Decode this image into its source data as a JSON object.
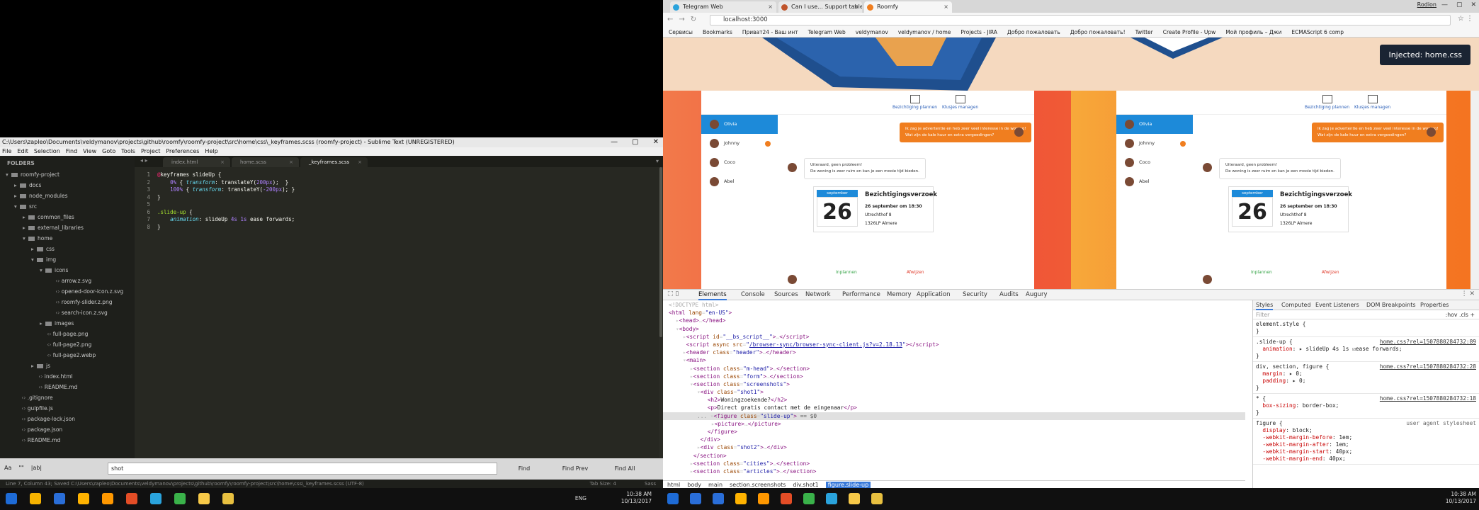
{
  "sublime": {
    "title": "C:\\Users\\zapleo\\Documents\\veldymanov\\projects\\github\\roomfy\\roomfy-project\\src\\home\\css\\_keyframes.scss (roomfy-project) - Sublime Text (UNREGISTERED)",
    "menu": [
      "File",
      "Edit",
      "Selection",
      "Find",
      "View",
      "Goto",
      "Tools",
      "Project",
      "Preferences",
      "Help"
    ],
    "sidebar_heading": "FOLDERS",
    "tree": [
      {
        "label": "roomfy-project",
        "depth": 0,
        "arrow": "▾",
        "folder": true
      },
      {
        "label": "docs",
        "depth": 1,
        "arrow": "▸",
        "folder": true
      },
      {
        "label": "node_modules",
        "depth": 1,
        "arrow": "▸",
        "folder": true
      },
      {
        "label": "src",
        "depth": 1,
        "arrow": "▾",
        "folder": true
      },
      {
        "label": "common_files",
        "depth": 2,
        "arrow": "▸",
        "folder": true
      },
      {
        "label": "external_libraries",
        "depth": 2,
        "arrow": "▸",
        "folder": true
      },
      {
        "label": "home",
        "depth": 2,
        "arrow": "▾",
        "folder": true
      },
      {
        "label": "css",
        "depth": 3,
        "arrow": "▸",
        "folder": true
      },
      {
        "label": "img",
        "depth": 3,
        "arrow": "▾",
        "folder": true
      },
      {
        "label": "icons",
        "depth": 4,
        "arrow": "▾",
        "folder": true
      },
      {
        "label": "arrow.z.svg",
        "depth": 5,
        "arrow": "",
        "folder": false
      },
      {
        "label": "opened-door-icon.z.svg",
        "depth": 5,
        "arrow": "",
        "folder": false
      },
      {
        "label": "roomfy-slider.z.png",
        "depth": 5,
        "arrow": "",
        "folder": false
      },
      {
        "label": "search-icon.z.svg",
        "depth": 5,
        "arrow": "",
        "folder": false
      },
      {
        "label": "images",
        "depth": 4,
        "arrow": "▸",
        "folder": true
      },
      {
        "label": "full-page.png",
        "depth": 4,
        "arrow": "",
        "folder": false
      },
      {
        "label": "full-page2.png",
        "depth": 4,
        "arrow": "",
        "folder": false
      },
      {
        "label": "full-page2.webp",
        "depth": 4,
        "arrow": "",
        "folder": false
      },
      {
        "label": "js",
        "depth": 3,
        "arrow": "▸",
        "folder": true
      },
      {
        "label": "index.html",
        "depth": 3,
        "arrow": "",
        "folder": false
      },
      {
        "label": "README.md",
        "depth": 3,
        "arrow": "",
        "folder": false
      },
      {
        "label": ".gitignore",
        "depth": 1,
        "arrow": "",
        "folder": false
      },
      {
        "label": "gulpfile.js",
        "depth": 1,
        "arrow": "",
        "folder": false
      },
      {
        "label": "package-lock.json",
        "depth": 1,
        "arrow": "",
        "folder": false
      },
      {
        "label": "package.json",
        "depth": 1,
        "arrow": "",
        "folder": false
      },
      {
        "label": "README.md",
        "depth": 1,
        "arrow": "",
        "folder": false
      }
    ],
    "tabs": [
      {
        "label": "index.html",
        "active": false
      },
      {
        "label": "home.scss",
        "active": false
      },
      {
        "label": "_keyframes.scss",
        "active": true
      }
    ],
    "code": [
      {
        "n": "1",
        "html": "<span style='color:#f92672'>@</span><span style='color:#f8f8f2'>keyframes slideUp {</span>"
      },
      {
        "n": "2",
        "html": "    <span style='color:#ae81ff'>0%</span> <span style='color:#f8f8f2'>{</span> <span style='color:#66d9ef;font-style:italic'>transform</span><span style='color:#f8f8f2'>: translateY(</span><span style='color:#ae81ff'>200px</span><span style='color:#f8f8f2'>);  }</span>"
      },
      {
        "n": "3",
        "html": "    <span style='color:#ae81ff'>100%</span> <span style='color:#f8f8f2'>{</span> <span style='color:#66d9ef;font-style:italic'>transform</span><span style='color:#f8f8f2'>: translateY(</span><span style='color:#ae81ff'>-200px</span><span style='color:#f8f8f2'>); }</span>"
      },
      {
        "n": "4",
        "html": "<span style='color:#f8f8f2'>}</span>"
      },
      {
        "n": "5",
        "html": ""
      },
      {
        "n": "6",
        "html": "<span style='color:#a6e22e'>.slide-up</span> <span style='color:#f8f8f2'>{</span>"
      },
      {
        "n": "7",
        "html": "    <span style='color:#66d9ef;font-style:italic'>animation</span><span style='color:#f8f8f2'>: slideUp </span><span style='color:#ae81ff'>4s</span> <span style='color:#ae81ff'>1s</span><span style='color:#f8f8f2'> ease forwards;</span>"
      },
      {
        "n": "8",
        "html": "<span style='color:#f8f8f2'>}</span>"
      }
    ],
    "find": {
      "opts": [
        "Aa",
        "\"\"",
        "|ab|"
      ],
      "value": "shot",
      "find": "Find",
      "find_prev": "Find Prev",
      "find_all": "Find All"
    },
    "status_left": "Line 7, Column 43; Saved C:\\Users\\zapleo\\Documents\\veldymanov\\projects\\github\\roomfy\\roomfy-project\\src\\home\\css\\_keyframes.scss (UTF-8)",
    "tab_size": "Tab Size: 4",
    "syntax": "Sass"
  },
  "chrome": {
    "tabs": [
      {
        "label": "Telegram Web",
        "active": false,
        "color": "#2aa3dc"
      },
      {
        "label": "Can I use... Support table",
        "active": false,
        "color": "#c0542b"
      },
      {
        "label": "Roomfy",
        "active": true,
        "color": "#f07e1f"
      }
    ],
    "user": "Rodion",
    "url": "localhost:3000",
    "bookmarks": [
      "Сервисы",
      "Bookmarks",
      "Приват24 - Ваш инт",
      "Telegram Web",
      "veldymanov",
      "veldymanov / home",
      "Projects - JIRA",
      "Добро пожаловать",
      "Добро пожаловать!",
      "Twitter",
      "Create Profile - Upw",
      "Мой профиль – Джи",
      "ECMAScript 6 comp"
    ],
    "injected": "Injected: home.css"
  },
  "mock": {
    "topbar": [
      "Bezichtiging plannen",
      "Klusjes managen"
    ],
    "contacts": [
      {
        "name": "Olivia",
        "active": true,
        "badge": false
      },
      {
        "name": "Johnny",
        "active": false,
        "badge": true
      },
      {
        "name": "Coco",
        "active": false,
        "badge": false
      },
      {
        "name": "Abel",
        "active": false,
        "badge": false
      }
    ],
    "msg1a": "Ik zag je advertentie en heb zeer veel interesse in de woning!",
    "msg1b": "Wat zijn de kale huur en extra vergoedingen?",
    "msg2a": "Uiteraard, geen probleem!",
    "msg2b": "De woning is zeer ruim en kan je een mooie tijd bieden.",
    "month": "september",
    "day": "26",
    "card_title": "Bezichtigingsverzoek",
    "card_when": "26 september om 18:30",
    "card_addr1": "Utrechthof 8",
    "card_addr2": "1326LP Almere",
    "accept": "Inplannen",
    "decline": "Afwijzen"
  },
  "devtools": {
    "tabs": [
      "Elements",
      "Console",
      "Sources",
      "Network",
      "Performance",
      "Memory",
      "Application",
      "Security",
      "Audits",
      "Augury"
    ],
    "dom": [
      {
        "i": 0,
        "h": "<span class='cm'>&lt;!DOCTYPE html&gt;</span>"
      },
      {
        "i": 0,
        "h": "<span class='tg'>&lt;html</span> <span class='at'>lang</span>=<span class='av2'>\"en-US\"</span><span class='tg'>&gt;</span>"
      },
      {
        "i": 1,
        "h": "▸<span class='tg'>&lt;head&gt;</span>…<span class='tg'>&lt;/head&gt;</span>"
      },
      {
        "i": 1,
        "h": "▾<span class='tg'>&lt;body&gt;</span>"
      },
      {
        "i": 2,
        "h": "▸<span class='tg'>&lt;script</span> <span class='at'>id</span>=<span class='av2'>\"__bs_script__\"</span><span class='tg'>&gt;</span>…<span class='tg'>&lt;/script&gt;</span>"
      },
      {
        "i": 2,
        "h": " <span class='tg'>&lt;script</span> <span class='at'>async src</span>=<span class='av2'>\"<span class='ln2'>/browser-sync/browser-sync-client.js?v=2.18.13</span>\"</span><span class='tg'>&gt;&lt;/script&gt;</span>"
      },
      {
        "i": 2,
        "h": "▸<span class='tg'>&lt;header</span> <span class='at'>class</span>=<span class='av2'>\"header\"</span><span class='tg'>&gt;</span>…<span class='tg'>&lt;/header&gt;</span>"
      },
      {
        "i": 2,
        "h": "▾<span class='tg'>&lt;main&gt;</span>"
      },
      {
        "i": 3,
        "h": "▸<span class='tg'>&lt;section</span> <span class='at'>class</span>=<span class='av2'>\"m-head\"</span><span class='tg'>&gt;</span>…<span class='tg'>&lt;/section&gt;</span>"
      },
      {
        "i": 3,
        "h": "▸<span class='tg'>&lt;section</span> <span class='at'>class</span>=<span class='av2'>\"form\"</span><span class='tg'>&gt;</span>…<span class='tg'>&lt;/section&gt;</span>"
      },
      {
        "i": 3,
        "h": "▾<span class='tg'>&lt;section</span> <span class='at'>class</span>=<span class='av2'>\"screenshots\"</span><span class='tg'>&gt;</span>"
      },
      {
        "i": 4,
        "h": "▾<span class='tg'>&lt;div</span> <span class='at'>class</span>=<span class='av2'>\"shot1\"</span><span class='tg'>&gt;</span>"
      },
      {
        "i": 5,
        "h": " <span class='tg'>&lt;h2&gt;</span><span class='tx'>Woningzoekende?</span><span class='tg'>&lt;/h2&gt;</span>"
      },
      {
        "i": 5,
        "h": " <span class='tg'>&lt;p&gt;</span><span class='tx'>Direct gratis contact met de eingenaar</span><span class='tg'>&lt;/p&gt;</span>"
      },
      {
        "i": 4,
        "h": "<span style='color:#999'>...</span> ▾<span class='tg'>&lt;figure</span> <span class='at'>class</span>=<span class='av2'>\"slide-up\"</span><span class='tg'>&gt;</span> <span style='color:#555'>== $0</span>",
        "sel": true
      },
      {
        "i": 6,
        "h": "▸<span class='tg'>&lt;picture&gt;</span>…<span class='tg'>&lt;/picture&gt;</span>"
      },
      {
        "i": 5,
        "h": " <span class='tg'>&lt;/figure&gt;</span>"
      },
      {
        "i": 4,
        "h": " <span class='tg'>&lt;/div&gt;</span>"
      },
      {
        "i": 4,
        "h": "▸<span class='tg'>&lt;div</span> <span class='at'>class</span>=<span class='av2'>\"shot2\"</span><span class='tg'>&gt;</span>…<span class='tg'>&lt;/div&gt;</span>"
      },
      {
        "i": 3,
        "h": " <span class='tg'>&lt;/section&gt;</span>"
      },
      {
        "i": 3,
        "h": "▸<span class='tg'>&lt;section</span> <span class='at'>class</span>=<span class='av2'>\"cities\"</span><span class='tg'>&gt;</span>…<span class='tg'>&lt;/section&gt;</span>"
      },
      {
        "i": 3,
        "h": "▸<span class='tg'>&lt;section</span> <span class='at'>class</span>=<span class='av2'>\"articles\"</span><span class='tg'>&gt;</span>…<span class='tg'>&lt;/section&gt;</span>"
      }
    ],
    "breadcrumb": [
      "html",
      "body",
      "main",
      "section.screenshots",
      "div.shot1",
      "figure.slide-up"
    ],
    "style_tabs": [
      "Styles",
      "Computed",
      "Event Listeners",
      "DOM Breakpoints",
      "Properties"
    ],
    "filter": "Filter",
    "filter_right": ":hov  .cls  +",
    "rules": [
      {
        "sel": "element.style {",
        "props": [],
        "close": "}",
        "src": ""
      },
      {
        "sel": ".slide-up {",
        "props": [
          {
            "n": "animation",
            "v": "▸ slideUp 4s 1s ☑ease forwards;"
          }
        ],
        "close": "}",
        "src": "home.css?rel=1507880284732:89"
      },
      {
        "sel": "div, section, figure {",
        "props": [
          {
            "n": "margin",
            "v": "▸ 0;"
          },
          {
            "n": "padding",
            "v": "▸ 0;"
          }
        ],
        "close": "}",
        "src": "home.css?rel=1507880284732:28"
      },
      {
        "sel": "* {",
        "props": [
          {
            "n": "box-sizing",
            "v": "border-box;"
          }
        ],
        "close": "}",
        "src": "home.css?rel=1507880284732:18"
      },
      {
        "sel": "figure {",
        "props": [
          {
            "n": "display",
            "v": "block;"
          },
          {
            "n": "-webkit-margin-before",
            "v": "1em;"
          },
          {
            "n": "-webkit-margin-after",
            "v": "1em;"
          },
          {
            "n": "-webkit-margin-start",
            "v": "40px;"
          },
          {
            "n": "-webkit-margin-end",
            "v": "40px;"
          }
        ],
        "close": "",
        "src": "user agent stylesheet"
      }
    ]
  },
  "taskbar": {
    "left_tray_lang": "ENG",
    "left_time": "10:38 AM",
    "left_date": "10/13/2017",
    "right_time": "10:38 AM",
    "right_date": "10/13/2017"
  }
}
